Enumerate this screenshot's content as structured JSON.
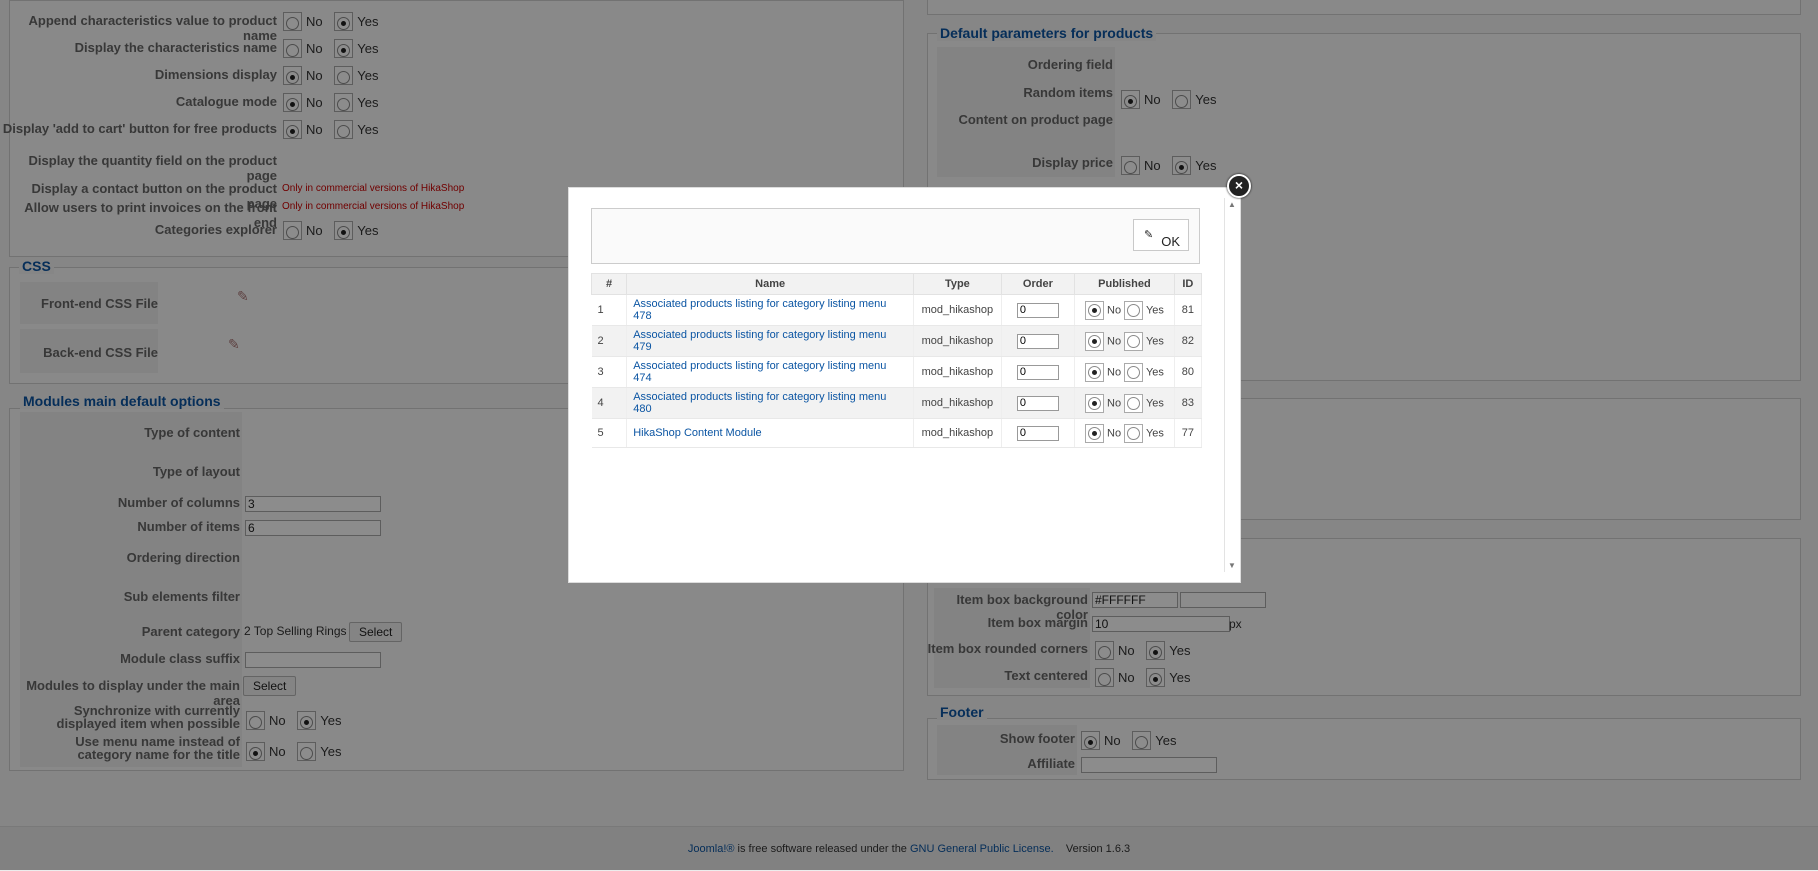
{
  "left": {
    "rows": [
      {
        "label": "Append characteristics value to product name",
        "value": "yes"
      },
      {
        "label": "Display the characteristics name",
        "value": "yes"
      },
      {
        "label": "Dimensions display",
        "value": "no"
      },
      {
        "label": "Catalogue mode",
        "value": "no"
      },
      {
        "label": "Display 'add to cart' button for free products",
        "value": "no"
      }
    ],
    "qty_label": "Display the quantity field on the product page",
    "contact_label": "Display a contact button on the product page",
    "print_label": "Allow users to print invoices on the front end",
    "commercial_note": "Only in commercial versions of HikaShop",
    "categories_label": "Categories explorer",
    "css_legend": "CSS",
    "frontend_css": "Front-end CSS File",
    "backend_css": "Back-end CSS File",
    "modules_legend": "Modules main default options",
    "type_content": "Type of content",
    "type_layout": "Type of layout",
    "num_columns": "Number of columns",
    "num_columns_val": "3",
    "num_items": "Number of items",
    "num_items_val": "6",
    "ordering_dir": "Ordering direction",
    "sub_filter": "Sub elements filter",
    "parent_cat": "Parent category",
    "parent_cat_val": "2 Top Selling Rings",
    "select": "Select",
    "class_suffix": "Module class suffix",
    "modules_under": "Modules to display under the main area",
    "sync_l1": "Synchronize with currently",
    "sync_l2": "displayed item when possible",
    "menu_l1": "Use menu name instead of",
    "menu_l2": "category name for the title"
  },
  "right": {
    "defaults_legend": "Default parameters for products",
    "ordering_field": "Ordering field",
    "random_items": "Random items",
    "content_on_page": "Content on product page",
    "display_price": "Display price",
    "bg_color": "Item box background color",
    "bg_color_val": "#FFFFFF",
    "margin": "Item box margin",
    "margin_val": "10",
    "px": "px",
    "rounded": "Item box rounded corners",
    "text_centered": "Text centered",
    "footer_legend": "Footer",
    "show_footer": "Show footer",
    "affiliate": "Affiliate"
  },
  "radio": {
    "no": "No",
    "yes": "Yes"
  },
  "modal": {
    "ok": "OK",
    "columns": [
      "#",
      "Name",
      "Type",
      "Order",
      "Published",
      "ID"
    ],
    "rows": [
      {
        "num": "1",
        "name": "Associated products listing for category listing menu 478",
        "type": "mod_hikashop",
        "order": "0",
        "id": "81"
      },
      {
        "num": "2",
        "name": "Associated products listing for category listing menu 479",
        "type": "mod_hikashop",
        "order": "0",
        "id": "82"
      },
      {
        "num": "3",
        "name": "Associated products listing for category listing menu 474",
        "type": "mod_hikashop",
        "order": "0",
        "id": "80"
      },
      {
        "num": "4",
        "name": "Associated products listing for category listing menu 480",
        "type": "mod_hikashop",
        "order": "0",
        "id": "83"
      },
      {
        "num": "5",
        "name": "HikaShop Content Module",
        "type": "mod_hikashop",
        "order": "0",
        "id": "77"
      }
    ]
  },
  "footer": {
    "joomla": "Joomla!®",
    "text1": " is free software released under the ",
    "gpl": "GNU General Public License.",
    "version": "Version 1.6.3"
  }
}
